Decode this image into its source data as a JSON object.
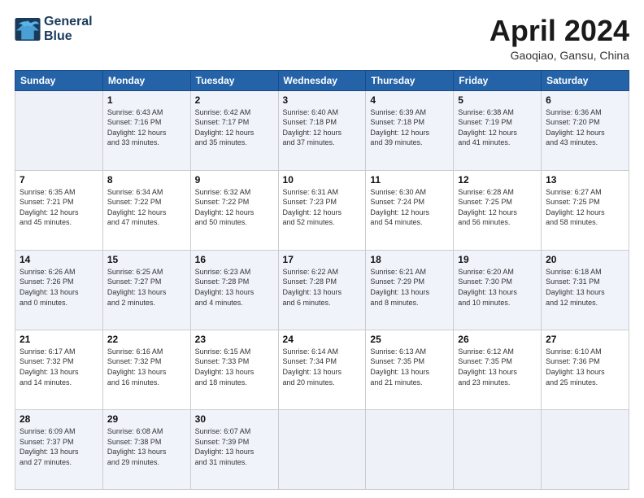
{
  "logo": {
    "line1": "General",
    "line2": "Blue"
  },
  "title": "April 2024",
  "subtitle": "Gaoqiao, Gansu, China",
  "weekdays": [
    "Sunday",
    "Monday",
    "Tuesday",
    "Wednesday",
    "Thursday",
    "Friday",
    "Saturday"
  ],
  "weeks": [
    [
      {
        "day": "",
        "info": ""
      },
      {
        "day": "1",
        "info": "Sunrise: 6:43 AM\nSunset: 7:16 PM\nDaylight: 12 hours\nand 33 minutes."
      },
      {
        "day": "2",
        "info": "Sunrise: 6:42 AM\nSunset: 7:17 PM\nDaylight: 12 hours\nand 35 minutes."
      },
      {
        "day": "3",
        "info": "Sunrise: 6:40 AM\nSunset: 7:18 PM\nDaylight: 12 hours\nand 37 minutes."
      },
      {
        "day": "4",
        "info": "Sunrise: 6:39 AM\nSunset: 7:18 PM\nDaylight: 12 hours\nand 39 minutes."
      },
      {
        "day": "5",
        "info": "Sunrise: 6:38 AM\nSunset: 7:19 PM\nDaylight: 12 hours\nand 41 minutes."
      },
      {
        "day": "6",
        "info": "Sunrise: 6:36 AM\nSunset: 7:20 PM\nDaylight: 12 hours\nand 43 minutes."
      }
    ],
    [
      {
        "day": "7",
        "info": "Sunrise: 6:35 AM\nSunset: 7:21 PM\nDaylight: 12 hours\nand 45 minutes."
      },
      {
        "day": "8",
        "info": "Sunrise: 6:34 AM\nSunset: 7:22 PM\nDaylight: 12 hours\nand 47 minutes."
      },
      {
        "day": "9",
        "info": "Sunrise: 6:32 AM\nSunset: 7:22 PM\nDaylight: 12 hours\nand 50 minutes."
      },
      {
        "day": "10",
        "info": "Sunrise: 6:31 AM\nSunset: 7:23 PM\nDaylight: 12 hours\nand 52 minutes."
      },
      {
        "day": "11",
        "info": "Sunrise: 6:30 AM\nSunset: 7:24 PM\nDaylight: 12 hours\nand 54 minutes."
      },
      {
        "day": "12",
        "info": "Sunrise: 6:28 AM\nSunset: 7:25 PM\nDaylight: 12 hours\nand 56 minutes."
      },
      {
        "day": "13",
        "info": "Sunrise: 6:27 AM\nSunset: 7:25 PM\nDaylight: 12 hours\nand 58 minutes."
      }
    ],
    [
      {
        "day": "14",
        "info": "Sunrise: 6:26 AM\nSunset: 7:26 PM\nDaylight: 13 hours\nand 0 minutes."
      },
      {
        "day": "15",
        "info": "Sunrise: 6:25 AM\nSunset: 7:27 PM\nDaylight: 13 hours\nand 2 minutes."
      },
      {
        "day": "16",
        "info": "Sunrise: 6:23 AM\nSunset: 7:28 PM\nDaylight: 13 hours\nand 4 minutes."
      },
      {
        "day": "17",
        "info": "Sunrise: 6:22 AM\nSunset: 7:28 PM\nDaylight: 13 hours\nand 6 minutes."
      },
      {
        "day": "18",
        "info": "Sunrise: 6:21 AM\nSunset: 7:29 PM\nDaylight: 13 hours\nand 8 minutes."
      },
      {
        "day": "19",
        "info": "Sunrise: 6:20 AM\nSunset: 7:30 PM\nDaylight: 13 hours\nand 10 minutes."
      },
      {
        "day": "20",
        "info": "Sunrise: 6:18 AM\nSunset: 7:31 PM\nDaylight: 13 hours\nand 12 minutes."
      }
    ],
    [
      {
        "day": "21",
        "info": "Sunrise: 6:17 AM\nSunset: 7:32 PM\nDaylight: 13 hours\nand 14 minutes."
      },
      {
        "day": "22",
        "info": "Sunrise: 6:16 AM\nSunset: 7:32 PM\nDaylight: 13 hours\nand 16 minutes."
      },
      {
        "day": "23",
        "info": "Sunrise: 6:15 AM\nSunset: 7:33 PM\nDaylight: 13 hours\nand 18 minutes."
      },
      {
        "day": "24",
        "info": "Sunrise: 6:14 AM\nSunset: 7:34 PM\nDaylight: 13 hours\nand 20 minutes."
      },
      {
        "day": "25",
        "info": "Sunrise: 6:13 AM\nSunset: 7:35 PM\nDaylight: 13 hours\nand 21 minutes."
      },
      {
        "day": "26",
        "info": "Sunrise: 6:12 AM\nSunset: 7:35 PM\nDaylight: 13 hours\nand 23 minutes."
      },
      {
        "day": "27",
        "info": "Sunrise: 6:10 AM\nSunset: 7:36 PM\nDaylight: 13 hours\nand 25 minutes."
      }
    ],
    [
      {
        "day": "28",
        "info": "Sunrise: 6:09 AM\nSunset: 7:37 PM\nDaylight: 13 hours\nand 27 minutes."
      },
      {
        "day": "29",
        "info": "Sunrise: 6:08 AM\nSunset: 7:38 PM\nDaylight: 13 hours\nand 29 minutes."
      },
      {
        "day": "30",
        "info": "Sunrise: 6:07 AM\nSunset: 7:39 PM\nDaylight: 13 hours\nand 31 minutes."
      },
      {
        "day": "",
        "info": ""
      },
      {
        "day": "",
        "info": ""
      },
      {
        "day": "",
        "info": ""
      },
      {
        "day": "",
        "info": ""
      }
    ]
  ]
}
